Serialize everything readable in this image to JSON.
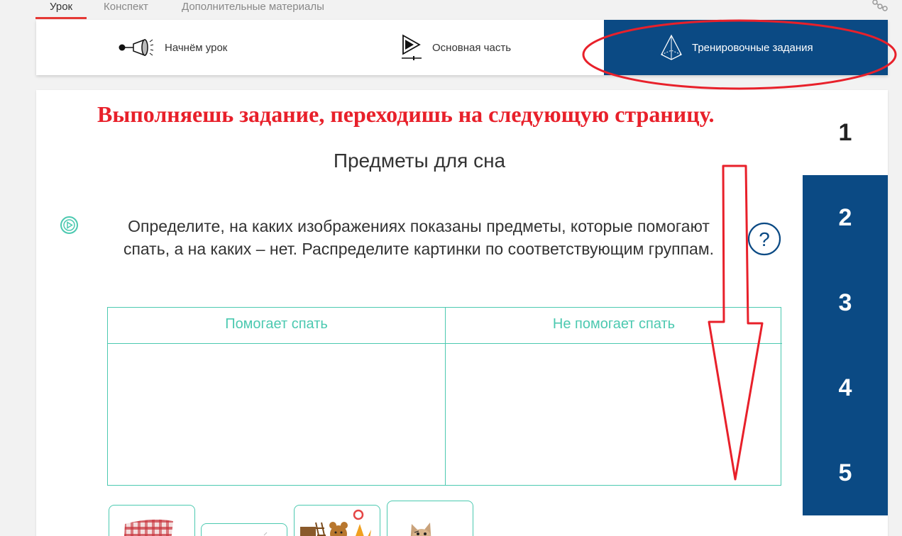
{
  "topnav": {
    "tabs": [
      {
        "label": "Урок",
        "active": true
      },
      {
        "label": "Конспект",
        "active": false
      },
      {
        "label": "Дополнительные материалы",
        "active": false
      }
    ],
    "share_icon": "share-icon"
  },
  "sections": [
    {
      "label": "Начнём урок",
      "icon": "megaphone-icon",
      "active": false
    },
    {
      "label": "Основная часть",
      "icon": "video-play-icon",
      "active": false
    },
    {
      "label": "Тренировочные задания",
      "icon": "pyramid-icon",
      "active": true
    }
  ],
  "annotation": {
    "text": "Выполняешь задание, переходишь на следующую страницу.",
    "color": "#e8202a"
  },
  "task": {
    "title": "Предметы для сна",
    "instruction": "Определите, на каких изображениях показаны предметы, которые помогают спать, а на каких – нет. Распределите картинки по соответствующим группам.",
    "columns": [
      "Помогает спать",
      "Не помогает спать"
    ]
  },
  "pager": {
    "pages": [
      "1",
      "2",
      "3",
      "4",
      "5"
    ],
    "current": "1"
  },
  "colors": {
    "brand": "#0b4a84",
    "accent_teal": "#4cc9b0",
    "tab_underline": "#e53935",
    "annotation_red": "#e8202a"
  },
  "picture_cards": [
    {
      "icon": "pillow-image"
    },
    {
      "icon": "blank-card-image"
    },
    {
      "icon": "toys-image"
    },
    {
      "icon": "kitten-image"
    }
  ]
}
